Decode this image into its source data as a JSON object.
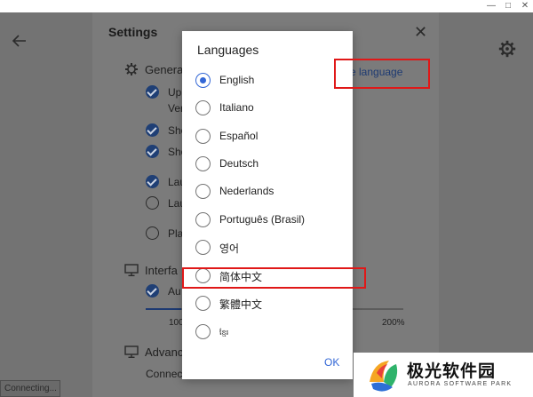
{
  "window": {
    "minimize": "—",
    "maximize": "□",
    "close": "✕"
  },
  "settings": {
    "title": "Settings",
    "close": "✕",
    "general": {
      "label": "Genera",
      "change_language": "e language",
      "rows": [
        {
          "text": "Up",
          "checked": true
        },
        {
          "text": "Ver",
          "checked": null
        },
        {
          "text": "Sho",
          "checked": true
        },
        {
          "text": "Sho",
          "checked": true
        },
        {
          "text": "Lau",
          "checked": true
        },
        {
          "text": "Lau",
          "checked": false
        },
        {
          "text": "Pla",
          "checked": false
        }
      ]
    },
    "interface": {
      "label": "Interfa",
      "row": "Au",
      "scale_min": "100",
      "scale_max": "200%"
    },
    "advanced": {
      "label": "Advanc",
      "row": "Connect"
    }
  },
  "status": {
    "text": "Connecting..."
  },
  "dialog": {
    "title": "Languages",
    "selected_index": 0,
    "languages": [
      "English",
      "Italiano",
      "Español",
      "Deutsch",
      "Nederlands",
      "Português (Brasil)",
      "영어",
      "简体中文",
      "繁體中文",
      "ខ្មែរ"
    ],
    "ok_label": "OK"
  },
  "watermark": {
    "name": "极光软件园",
    "subtitle": "AURORA SOFTWARE PARK"
  },
  "colors": {
    "accent": "#3367d6",
    "annotation": "#e01818",
    "overlay": "#737373"
  }
}
